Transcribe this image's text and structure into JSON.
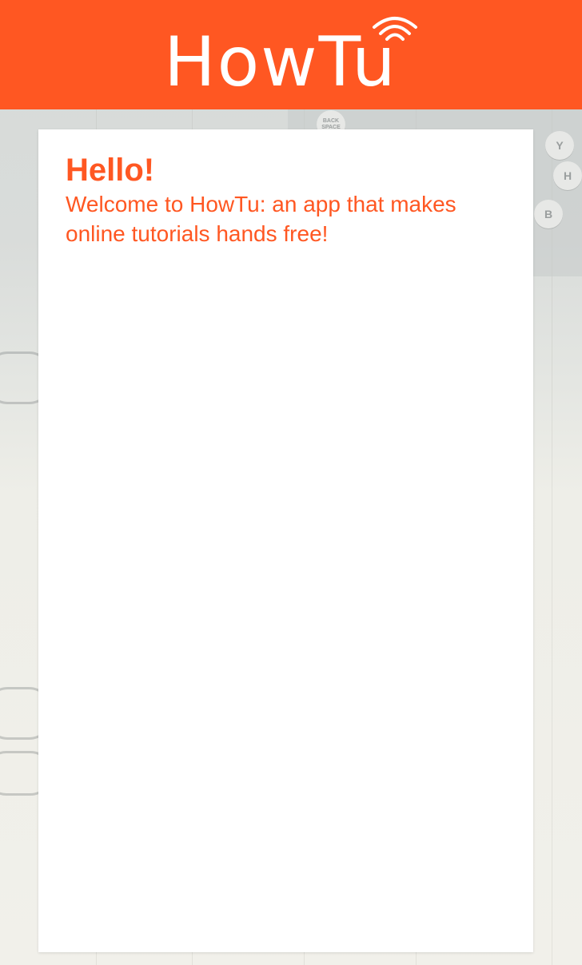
{
  "app": {
    "logo_text": "HowTu",
    "brand_color": "#ff5722"
  },
  "card": {
    "greeting": "Hello!",
    "welcome": "Welcome to HowTu: an app that makes online tutorials hands free!"
  },
  "background": {
    "keys": [
      "BACK SPACE",
      "Y",
      "H",
      "B"
    ]
  }
}
